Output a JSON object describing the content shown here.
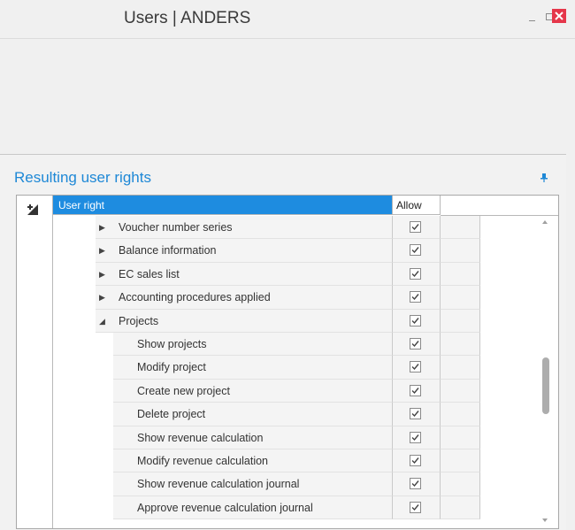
{
  "window": {
    "title": "Users | ANDERS"
  },
  "panel": {
    "title": "Resulting user rights"
  },
  "grid": {
    "columns": {
      "user_right": "User right",
      "allow": "Allow"
    },
    "rows": [
      {
        "label": "Voucher number series",
        "level": 1,
        "expander": "collapsed",
        "allow": true
      },
      {
        "label": "Balance information",
        "level": 1,
        "expander": "collapsed",
        "allow": true
      },
      {
        "label": "EC sales list",
        "level": 1,
        "expander": "collapsed",
        "allow": true
      },
      {
        "label": "Accounting procedures applied",
        "level": 1,
        "expander": "collapsed",
        "allow": true
      },
      {
        "label": "Projects",
        "level": 1,
        "expander": "expanded",
        "allow": true
      },
      {
        "label": "Show projects",
        "level": 2,
        "expander": "none",
        "allow": true
      },
      {
        "label": "Modify project",
        "level": 2,
        "expander": "none",
        "allow": true
      },
      {
        "label": "Create new project",
        "level": 2,
        "expander": "none",
        "allow": true
      },
      {
        "label": "Delete project",
        "level": 2,
        "expander": "none",
        "allow": true
      },
      {
        "label": "Show revenue calculation",
        "level": 2,
        "expander": "none",
        "allow": true
      },
      {
        "label": "Modify revenue calculation",
        "level": 2,
        "expander": "none",
        "allow": true
      },
      {
        "label": "Show revenue calculation journal",
        "level": 2,
        "expander": "none",
        "allow": true
      },
      {
        "label": "Approve revenue calculation journal",
        "level": 2,
        "expander": "none",
        "allow": true
      }
    ]
  },
  "colors": {
    "accent": "#1e88d6",
    "header_selected": "#1e8ce0",
    "close_button": "#e5364a"
  }
}
